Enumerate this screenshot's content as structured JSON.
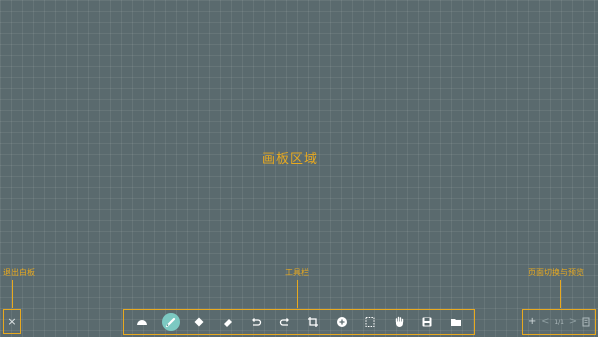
{
  "annotations": {
    "canvas_area": "画板区域",
    "exit_whiteboard": "退出白板",
    "toolbar": "工具栏",
    "page_switch_preview": "页面切换与预览"
  },
  "toolbar_tools": [
    {
      "name": "select-tool",
      "icon": "hemisphere-icon"
    },
    {
      "name": "pen-tool",
      "icon": "pen-icon",
      "active": true
    },
    {
      "name": "brush-tool",
      "icon": "diamond-icon"
    },
    {
      "name": "eraser-tool",
      "icon": "eraser-icon"
    },
    {
      "name": "undo-tool",
      "icon": "undo-icon"
    },
    {
      "name": "redo-tool",
      "icon": "redo-icon"
    },
    {
      "name": "crop-tool",
      "icon": "crop-icon"
    },
    {
      "name": "add-tool",
      "icon": "add-circle-icon"
    },
    {
      "name": "selection-tool",
      "icon": "dashed-rect-icon"
    },
    {
      "name": "hand-tool",
      "icon": "hand-icon"
    },
    {
      "name": "save-tool",
      "icon": "save-icon"
    },
    {
      "name": "folder-tool",
      "icon": "folder-icon"
    }
  ],
  "pager": {
    "add": "+",
    "prev": "<",
    "page_indicator": "1/1",
    "next": ">",
    "preview_icon": "preview-icon"
  },
  "exit_button": {
    "icon": "close-icon",
    "glyph": "×"
  },
  "colors": {
    "background": "#5a6a6e",
    "accent": "#e8a91f",
    "active_tool": "#7cc9c2"
  }
}
